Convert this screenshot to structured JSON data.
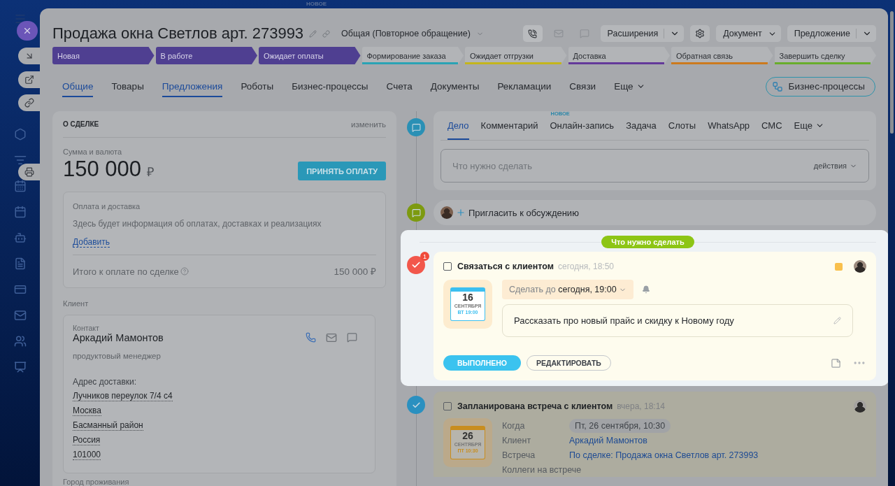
{
  "background_badge": "НОВОЕ",
  "title": "Продажа окна Светлов арт. 273993",
  "category": "Общая (Повторное обращение)",
  "header_buttons": [
    {
      "label": "Расширения",
      "kind": "split"
    },
    {
      "label": "Документ",
      "kind": "dropdown"
    },
    {
      "label": "Предложение",
      "kind": "split"
    }
  ],
  "stages": [
    {
      "label": "Новая",
      "color": "#4f3f91",
      "reached": true
    },
    {
      "label": "В работе",
      "color": "#4f3f91",
      "reached": true
    },
    {
      "label": "Ожидает оплаты",
      "color": "#4f3f91",
      "reached": true
    },
    {
      "label": "Формирование заказа",
      "color": "#2aa3b5",
      "reached": false
    },
    {
      "label": "Ожидает отгрузки",
      "color": "#c4b51c",
      "reached": false
    },
    {
      "label": "Доставка",
      "color": "#64399a",
      "reached": false
    },
    {
      "label": "Обратная связь",
      "color": "#cc7a1e",
      "reached": false
    },
    {
      "label": "Завершить сделку",
      "color": "#68ad2c",
      "reached": false
    }
  ],
  "tabs": [
    {
      "label": "Общие",
      "selected": true
    },
    {
      "label": "Товары",
      "selected": false
    },
    {
      "label": "Предложения",
      "selected": true
    },
    {
      "label": "Роботы",
      "selected": false
    },
    {
      "label": "Бизнес-процессы",
      "selected": false
    },
    {
      "label": "Счета",
      "selected": false
    },
    {
      "label": "Документы",
      "selected": false
    },
    {
      "label": "Рекламации",
      "selected": false
    },
    {
      "label": "Связи",
      "selected": false
    },
    {
      "label": "Еще",
      "selected": false,
      "kind": "more"
    }
  ],
  "process_button": "Бизнес-процессы",
  "deal": {
    "heading": "О СДЕЛКЕ",
    "edit": "изменить",
    "amount_label": "Сумма и валюта",
    "amount": "150 000",
    "currency": "₽",
    "pay_button": "ПРИНЯТЬ ОПЛАТУ",
    "payment": {
      "title": "Оплата и доставка",
      "text": "Здесь будет информация об оплатах, доставках и реализациях",
      "add_link": "Добавить",
      "total_label": "Итого к оплате по сделке",
      "total": "150 000 ₽"
    },
    "client_label": "Клиент",
    "contact": {
      "label": "Контакт",
      "name": "Аркадий Мамонтов",
      "position": "продуктовый менеджер",
      "address_label": "Адрес доставки:",
      "address_lines": [
        "Лучников переулок 7/4 с4",
        "Москва",
        "Басманный район",
        "Россия",
        "101000"
      ]
    },
    "next_label": "Город проживания"
  },
  "composer": {
    "tabs": [
      {
        "label": "Дело",
        "selected": true
      },
      {
        "label": "Комментарий",
        "selected": false
      },
      {
        "label": "Онлайн-запись",
        "selected": false,
        "badge": "НОВОЕ"
      },
      {
        "label": "Задача",
        "selected": false
      },
      {
        "label": "Слоты",
        "selected": false
      },
      {
        "label": "WhatsApp",
        "selected": false
      },
      {
        "label": "СМС",
        "selected": false
      },
      {
        "label": "Еще",
        "selected": false,
        "kind": "more"
      }
    ],
    "placeholder": "Что нужно сделать",
    "actions": "действия"
  },
  "invite": "Пригласить к обсуждению",
  "section_label": "Что нужно сделать",
  "task": {
    "counter": "1",
    "checked": false,
    "title": "Связаться с клиентом",
    "time": "сегодня, 18:50",
    "calendar": {
      "day": "16",
      "month": "СЕНТЯБРЯ",
      "weekday": "ВТ 19:00"
    },
    "deadline": "Сделать до **сегодня, 19:00**",
    "description": "Рассказать про новый прайс и скидку к Новому году",
    "done_button": "ВЫПОЛНЕНО",
    "edit_button": "РЕДАКТИРОВАТЬ"
  },
  "meeting": {
    "checked": false,
    "title": "Запланирована встреча с клиентом",
    "time": "вчера, 18:14",
    "calendar": {
      "day": "26",
      "month": "СЕНТЯБРЯ",
      "weekday": "ПТ 10:30"
    },
    "fields": [
      {
        "label": "Когда",
        "value": "Пт, 26 сентября, 10:30",
        "kind": "chip"
      },
      {
        "label": "Клиент",
        "value": "Аркадий Мамонтов",
        "kind": "link"
      },
      {
        "label": "Встреча",
        "value": "По сделке: Продажа окна Светлов арт. 273993",
        "kind": "link"
      },
      {
        "label": "Коллеги на встрече",
        "kind": "label"
      }
    ]
  }
}
